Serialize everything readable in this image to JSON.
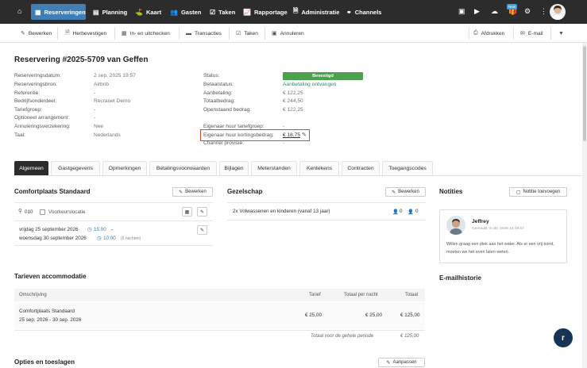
{
  "topnav": {
    "items": [
      {
        "label": "Reserveringen",
        "icon": "calendar-icon"
      },
      {
        "label": "Planning",
        "icon": "grid-icon"
      },
      {
        "label": "Kaart",
        "icon": "map-icon"
      },
      {
        "label": "Gasten",
        "icon": "users-icon"
      },
      {
        "label": "Taken",
        "icon": "task-icon"
      },
      {
        "label": "Rapportage",
        "icon": "chart-icon"
      },
      {
        "label": "Administratie",
        "icon": "document-icon"
      },
      {
        "label": "Channels",
        "icon": "network-icon"
      }
    ],
    "new_badge": "New"
  },
  "actions": {
    "left": [
      "Bewerken",
      "Herbevestigen",
      "In- en uitchecken",
      "Transacties",
      "Taken",
      "Annuleren"
    ],
    "right": [
      "Afdrukken",
      "E-mail"
    ]
  },
  "reservation": {
    "title": "Reservering #2025-5709 van Geffen",
    "left_labels": [
      "Reserveringsdatum:",
      "Reserveringsbron:",
      "Referentie:",
      "Bedrijfsonderdeel:",
      "Tariefgroep:",
      "Optioneel arrangement:",
      "Annuleringsverzekering:",
      "Taal:"
    ],
    "left_values": [
      "2 sep. 2025 19:57",
      "Airbnb",
      "-",
      "Recranet Demo",
      "-",
      "-",
      "Nee",
      "Nederlands"
    ],
    "right_labels": [
      "Status:",
      "Betaalstatus:",
      "Aanbetaling:",
      "Totaalbedrag:",
      "Openstaand bedrag:",
      "Eigenaar huur tariefgroep:",
      "Eigenaar huur kortingsbedrag:",
      "Channel provisie:"
    ],
    "status": "Bevestigd",
    "payment_status": "Aanbetaling ontvangen",
    "deposit": "€ 122,25",
    "total": "€ 244,50",
    "outstanding": "€ 122,25",
    "owner_rate_group": "-",
    "owner_discount": "€ 18,75",
    "channel_commission": "-"
  },
  "tabs": [
    "Algemeen",
    "Gastgegevens",
    "Opmerkingen",
    "Betalingsvoorwaarden",
    "Bijlagen",
    "Meterstanden",
    "Kentekens",
    "Contracten",
    "Toegangscodes"
  ],
  "pitch": {
    "title": "Comfortplaats Standaard",
    "edit": "Bewerken",
    "number": "010",
    "preference": "Voorkeurslocatie",
    "arrival": "vrijdag 25 september 2026",
    "arrival_time": "15.00",
    "departure": "woensdag 30 september 2026",
    "departure_time": "10:00",
    "nights": "(5 nachten)"
  },
  "company": {
    "title": "Gezelschap",
    "edit": "Bewerken",
    "description": "2x Volwassenen en kinderen (vanaf 13 jaar)",
    "adults": "0",
    "children": "0"
  },
  "notes": {
    "title": "Notities",
    "add": "Notitie toevoegen",
    "author": "Jeffrey",
    "created": "Gemaakt: 9 okt. 2026 14:18:57",
    "text": "Willen graag een plek aan het water. Als er een vrij komt, moeten we het even laten weten."
  },
  "email_history": {
    "title": "E-mailhistorie"
  },
  "rates": {
    "title": "Tarieven accommodatie",
    "headers": [
      "Omschrijving",
      "Tarief",
      "Totaal per nacht",
      "Totaal"
    ],
    "row": {
      "name": "Comfortplaats Standaard",
      "period": "25 sep. 2026 - 30 sep. 2026",
      "rate": "€ 25,00",
      "per_night": "€ 25,00",
      "total": "€ 125,00"
    },
    "footer_label": "Totaal voor de gehele periode",
    "footer_total": "€ 125,00"
  },
  "options": {
    "title": "Opties en toeslagen",
    "adjust": "Aanpassen"
  },
  "fab": {
    "label": "r"
  },
  "colors": {
    "topbar": "#2c2c2c",
    "active_nav": "#3f7fb5",
    "status_green": "#4da04d",
    "highlight": "#e0462d",
    "link_green": "#2e8c6e"
  }
}
